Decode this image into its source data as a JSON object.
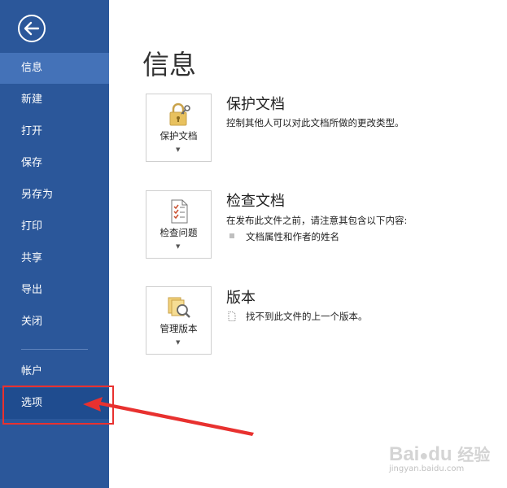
{
  "sidebar": {
    "items": [
      {
        "label": "信息",
        "state": "active"
      },
      {
        "label": "新建"
      },
      {
        "label": "打开"
      },
      {
        "label": "保存"
      },
      {
        "label": "另存为"
      },
      {
        "label": "打印"
      },
      {
        "label": "共享"
      },
      {
        "label": "导出"
      },
      {
        "label": "关闭"
      },
      {
        "label": "帐户"
      },
      {
        "label": "选项",
        "state": "selected"
      }
    ]
  },
  "main": {
    "title": "信息",
    "sections": [
      {
        "button_label": "保护文档",
        "title": "保护文档",
        "description": "控制其他人可以对此文档所做的更改类型。"
      },
      {
        "button_label": "检查问题",
        "title": "检查文档",
        "description": "在发布此文件之前，请注意其包含以下内容:",
        "bullet": "文档属性和作者的姓名"
      },
      {
        "button_label": "管理版本",
        "title": "版本",
        "description": "找不到此文件的上一个版本。"
      }
    ]
  },
  "watermark": {
    "brand": "Bai",
    "brand2": "du",
    "suffix": "经验",
    "url": "jingyan.baidu.com"
  },
  "colors": {
    "sidebar": "#2b579a",
    "active": "#4472b8",
    "annotation": "#e8312f"
  }
}
